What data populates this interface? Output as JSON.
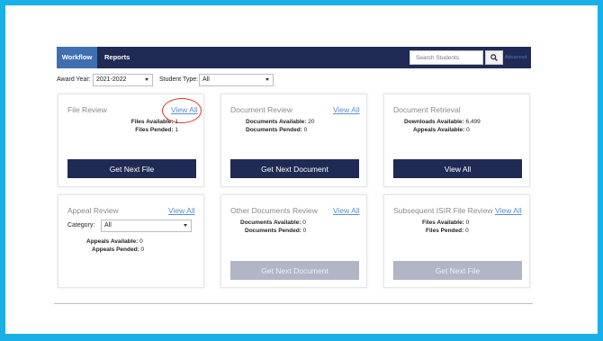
{
  "nav": {
    "tabs": [
      {
        "label": "Workflow",
        "active": true
      },
      {
        "label": "Reports",
        "active": false
      }
    ],
    "search": {
      "placeholder": "Search Students",
      "icon": "search-icon"
    },
    "advanced_label": "Advanced"
  },
  "filters": {
    "award_year_label": "Award Year:",
    "award_year_value": "2021-2022",
    "student_type_label": "Student Type:",
    "student_type_value": "All"
  },
  "cards": {
    "file_review": {
      "title": "File Review",
      "link": "View All",
      "stats": [
        {
          "label": "Files Available:",
          "value": "1"
        },
        {
          "label": "Files Pended:",
          "value": "1"
        }
      ],
      "button": "Get Next File"
    },
    "document_review": {
      "title": "Document Review",
      "link": "View All",
      "stats": [
        {
          "label": "Documents Available:",
          "value": "20"
        },
        {
          "label": "Documents Pended:",
          "value": "0"
        }
      ],
      "button": "Get Next Document"
    },
    "document_retrieval": {
      "title": "Document Retrieval",
      "stats": [
        {
          "label": "Downloads Available:",
          "value": "6,499"
        },
        {
          "label": "Appeals Available:",
          "value": "0"
        }
      ],
      "button": "View All"
    },
    "appeal_review": {
      "title": "Appeal Review",
      "link": "View All",
      "category_label": "Category:",
      "category_value": "All",
      "stats": [
        {
          "label": "Appeals Available:",
          "value": "0"
        },
        {
          "label": "Appeals Pended:",
          "value": "0"
        }
      ]
    },
    "other_documents_review": {
      "title": "Other Documents Review",
      "link": "View All",
      "stats": [
        {
          "label": "Documents Available:",
          "value": "0"
        },
        {
          "label": "Documents Pended:",
          "value": "0"
        }
      ],
      "button": "Get Next Document"
    },
    "subsequent_isir": {
      "title": "Subsequent ISIR File Review",
      "link": "View All",
      "stats": [
        {
          "label": "Files Available:",
          "value": "0"
        },
        {
          "label": "Files Pended:",
          "value": "0"
        }
      ],
      "button": "Get Next File"
    }
  },
  "colors": {
    "border": "#1ab0e6",
    "navbar": "#1f2a55",
    "active_tab": "#3f6fb0",
    "button": "#1f2a55",
    "button_disabled": "#b1b5c6",
    "link": "#5b8fc9",
    "annotation": "#d6332c"
  }
}
